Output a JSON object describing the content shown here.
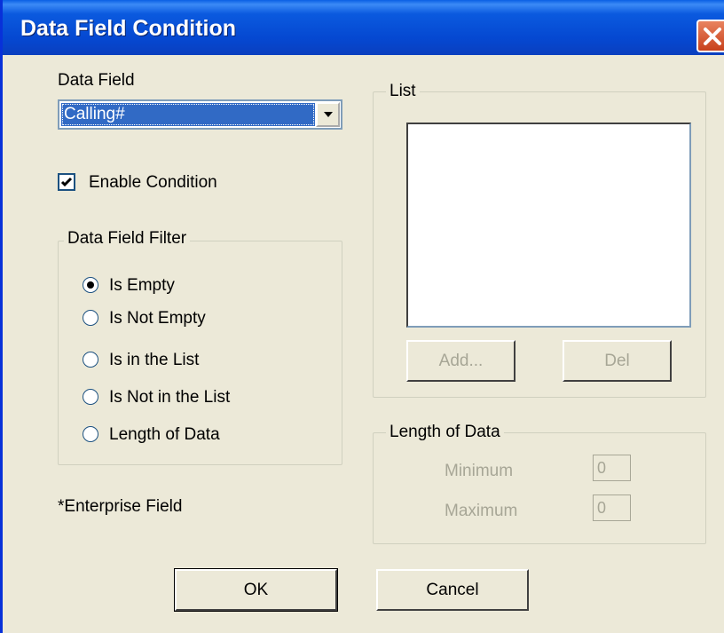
{
  "window": {
    "title": "Data Field Condition"
  },
  "data_field": {
    "label": "Data Field",
    "selected": "Calling#"
  },
  "enable_condition": {
    "label": "Enable Condition",
    "checked": true
  },
  "filter_group": {
    "title": "Data Field Filter",
    "options": [
      {
        "label": "Is Empty",
        "selected": true
      },
      {
        "label": "Is Not Empty",
        "selected": false
      },
      {
        "label": "Is in the List",
        "selected": false
      },
      {
        "label": "Is Not in the List",
        "selected": false
      },
      {
        "label": "Length of Data",
        "selected": false
      }
    ]
  },
  "list_group": {
    "title": "List",
    "add_label": "Add...",
    "del_label": "Del"
  },
  "length_group": {
    "title": "Length of Data",
    "minimum_label": "Minimum",
    "minimum_value": "0",
    "maximum_label": "Maximum",
    "maximum_value": "0"
  },
  "footnote": "*Enterprise Field",
  "buttons": {
    "ok": "OK",
    "cancel": "Cancel"
  },
  "colors": {
    "titlebar": "#0548d1",
    "dialog_bg": "#ece9d8",
    "selection": "#316ac5",
    "close_button": "#c8411c"
  }
}
